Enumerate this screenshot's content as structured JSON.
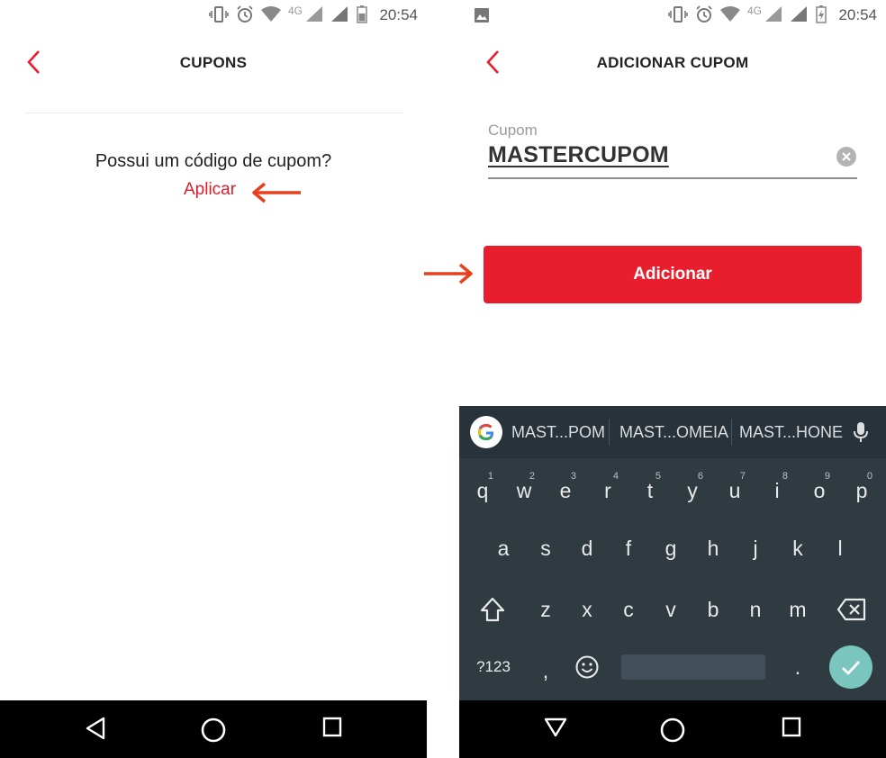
{
  "left_screen": {
    "status": {
      "time": "20:54",
      "network": "4G"
    },
    "appbar": {
      "title": "CUPONS"
    },
    "question": "Possui um código de cupom?",
    "apply_link": "Aplicar"
  },
  "right_screen": {
    "status": {
      "time": "20:54",
      "network": "4G"
    },
    "appbar": {
      "title": "ADICIONAR CUPOM"
    },
    "coupon_field": {
      "label": "Cupom",
      "value": "MASTERCUPOM"
    },
    "add_button": "Adicionar",
    "keyboard": {
      "suggestions": [
        "MAST...POM",
        "MAST...OMEIA",
        "MAST...HONE"
      ],
      "row1": [
        {
          "key": "q",
          "num": "1"
        },
        {
          "key": "w",
          "num": "2"
        },
        {
          "key": "e",
          "num": "3"
        },
        {
          "key": "r",
          "num": "4"
        },
        {
          "key": "t",
          "num": "5"
        },
        {
          "key": "y",
          "num": "6"
        },
        {
          "key": "u",
          "num": "7"
        },
        {
          "key": "i",
          "num": "8"
        },
        {
          "key": "o",
          "num": "9"
        },
        {
          "key": "p",
          "num": "0"
        }
      ],
      "row2": [
        "a",
        "s",
        "d",
        "f",
        "g",
        "h",
        "j",
        "k",
        "l"
      ],
      "row3": [
        "z",
        "x",
        "c",
        "v",
        "b",
        "n",
        "m"
      ],
      "row4": {
        "symbols": "?123",
        "comma": ",",
        "period": "."
      }
    }
  },
  "colors": {
    "accent_red": "#e81e2d",
    "link_red": "#d6202c",
    "annotation_arrow": "#e8401c",
    "keyboard_bg": "#2f3b40",
    "enter_key": "#7ac6be"
  }
}
